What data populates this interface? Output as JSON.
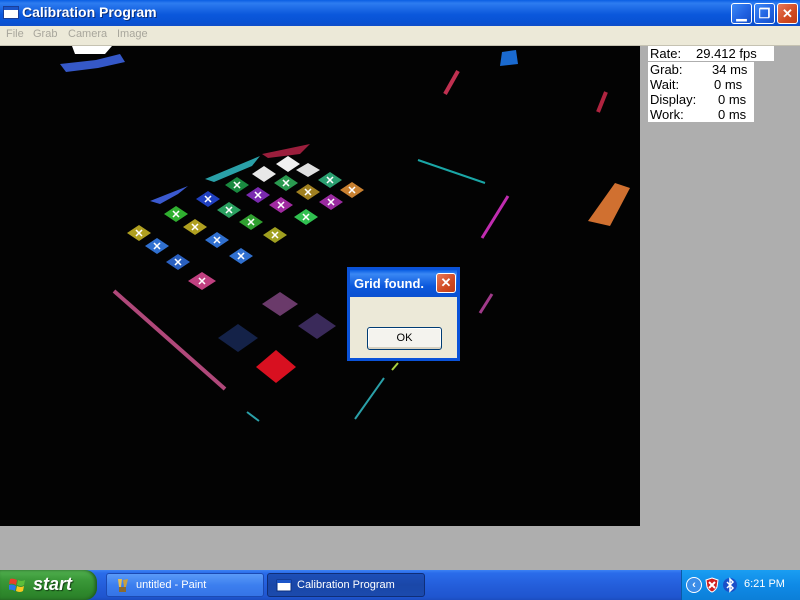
{
  "window": {
    "title": "Calibration Program",
    "minimize_symbol": "▁",
    "maximize_symbol": "❐",
    "close_symbol": "✕"
  },
  "menu": [
    "File",
    "Grab",
    "Camera",
    "Image"
  ],
  "stats": [
    {
      "label": "Rate:",
      "value": "29.412 fps"
    },
    {
      "label": "Grab:",
      "value": "34 ms"
    },
    {
      "label": "Wait:",
      "value": "0 ms"
    },
    {
      "label": "Display:",
      "value": "0 ms"
    },
    {
      "label": "Work:",
      "value": "0 ms"
    }
  ],
  "dialog": {
    "title": "Grid found.",
    "close_symbol": "✕",
    "ok_label": "OK"
  },
  "taskbar": {
    "start_label": "start",
    "tasks": [
      {
        "label": "untitled - Paint",
        "icon": "paint-icon"
      },
      {
        "label": "Calibration Program",
        "icon": "window-icon"
      }
    ],
    "tray_chevron": "‹",
    "clock": "6:21 PM"
  },
  "colors": {
    "titlebar_blue": "#0b58dc",
    "start_green": "#3c9a3a",
    "close_red": "#d04a22",
    "viewport_bg": "#030303"
  }
}
